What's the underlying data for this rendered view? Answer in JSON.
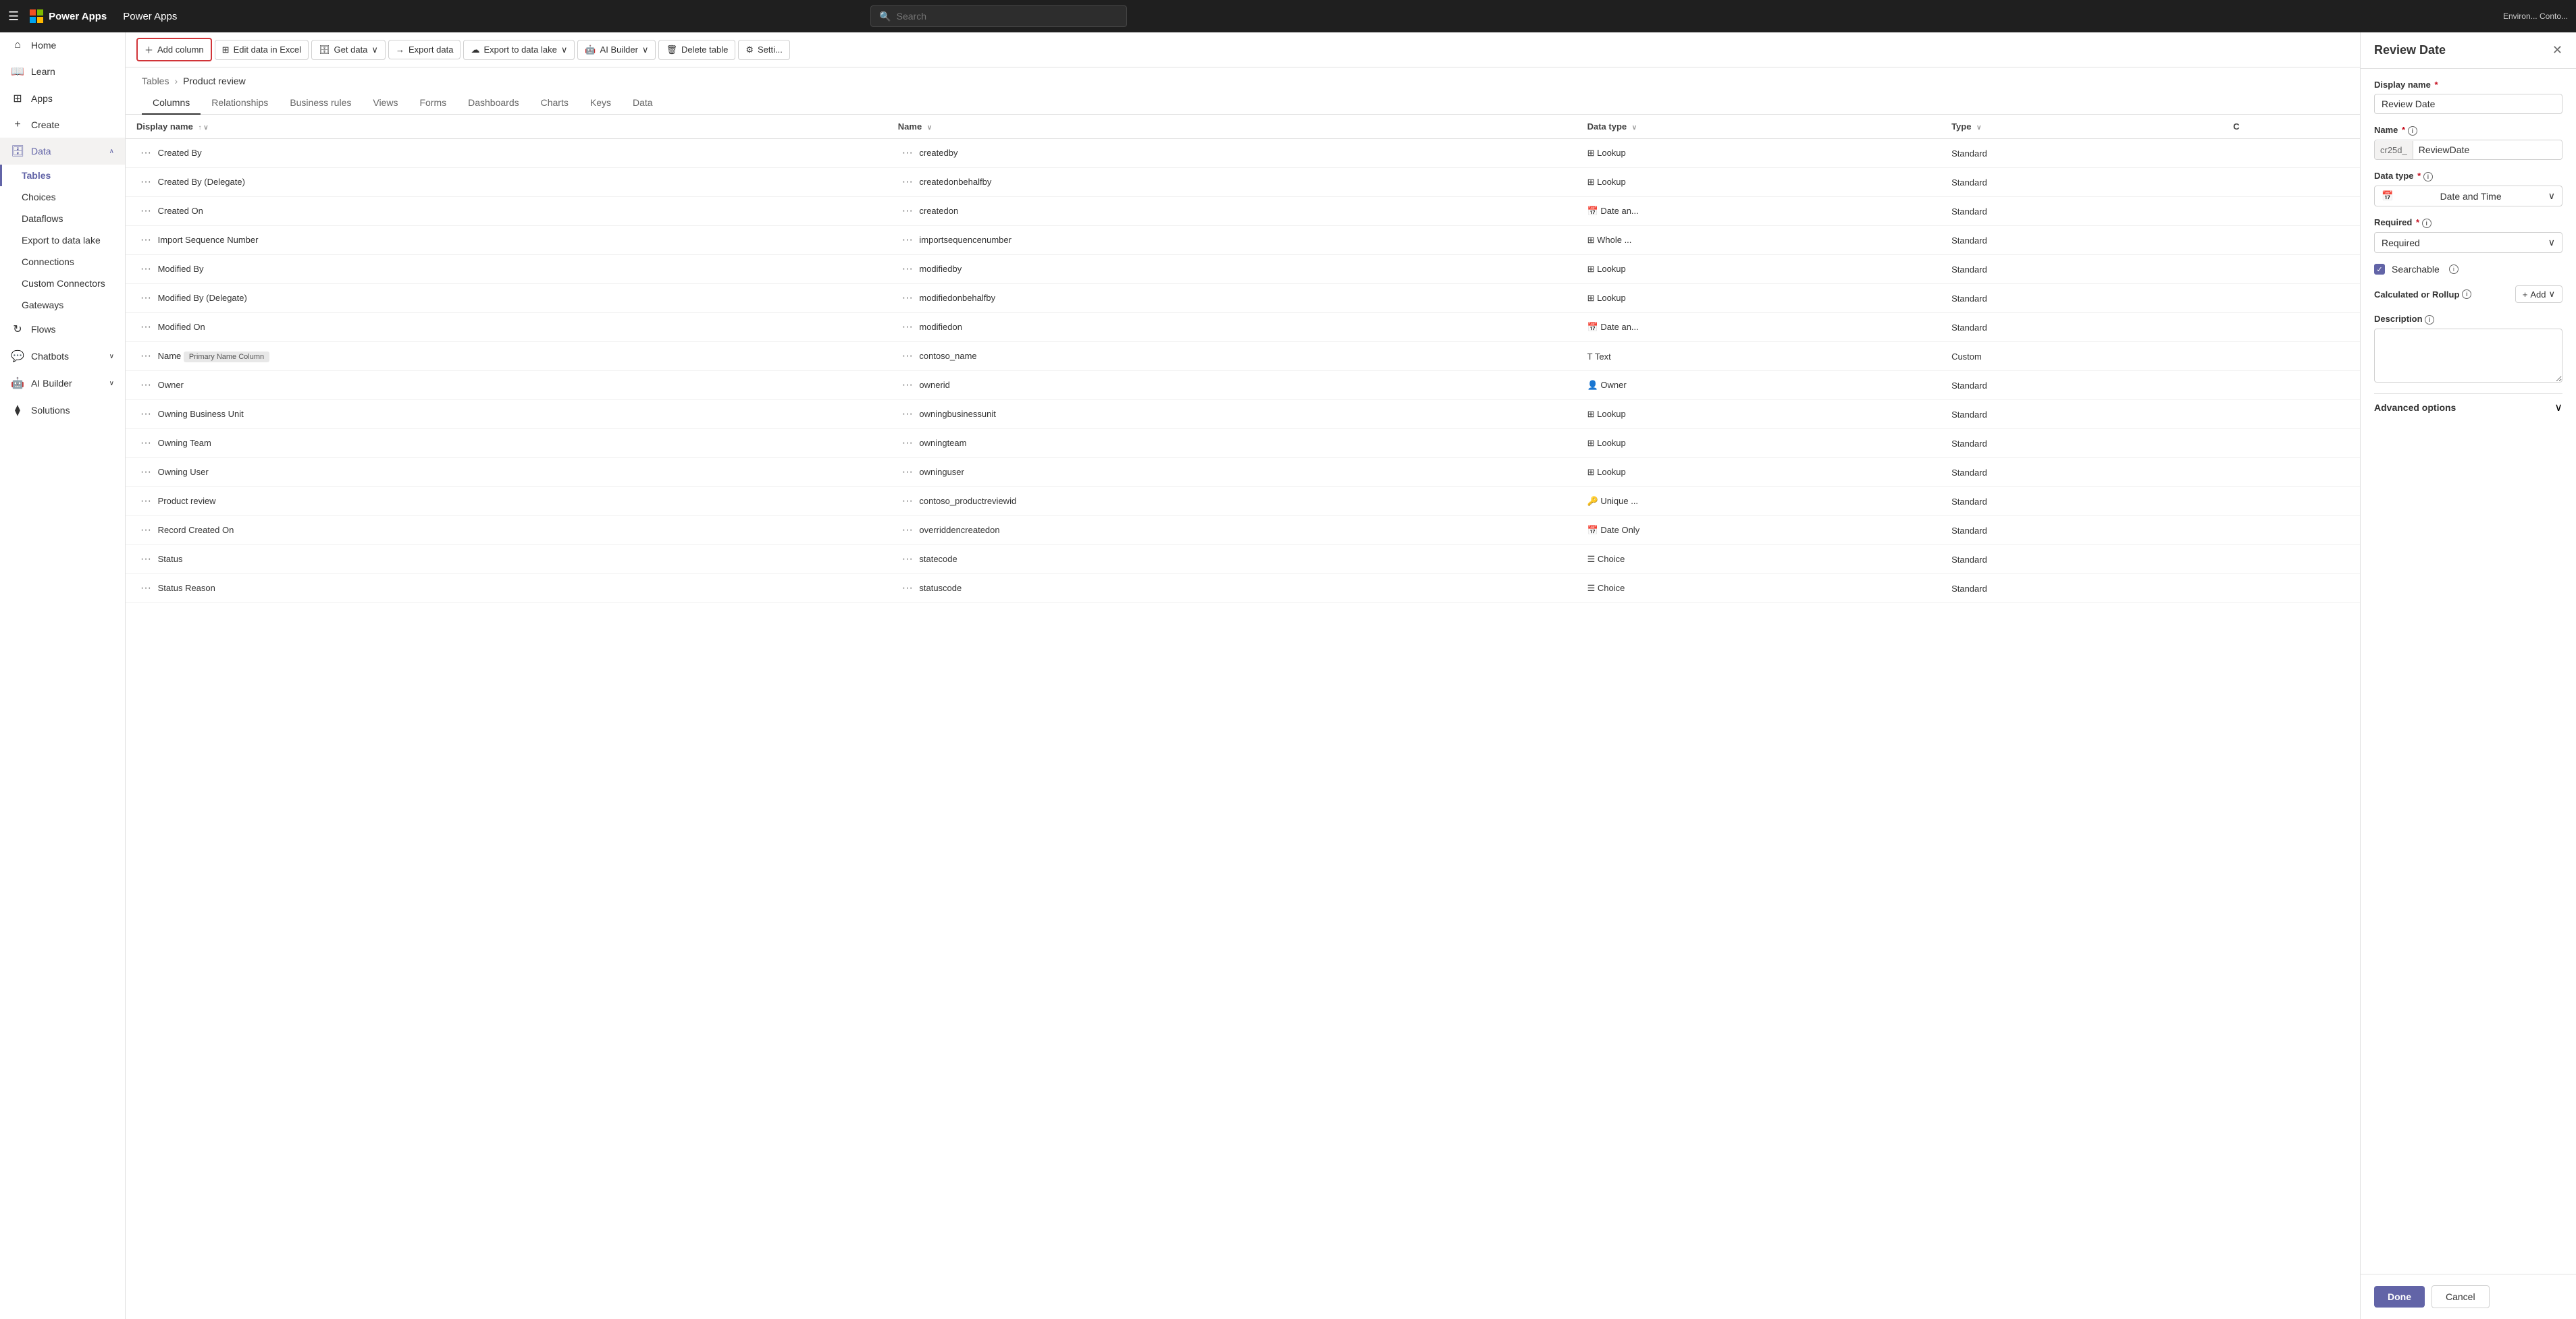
{
  "topnav": {
    "appName": "Power Apps",
    "searchPlaceholder": "Search",
    "envLabel": "Environ... Conto..."
  },
  "sidebar": {
    "items": [
      {
        "id": "home",
        "label": "Home",
        "icon": "⌂",
        "active": false
      },
      {
        "id": "learn",
        "label": "Learn",
        "icon": "📖",
        "active": false
      },
      {
        "id": "apps",
        "label": "Apps",
        "icon": "⊞",
        "active": false
      },
      {
        "id": "create",
        "label": "Create",
        "icon": "+",
        "active": false
      },
      {
        "id": "data",
        "label": "Data",
        "icon": "🗄",
        "active": true,
        "expanded": true
      }
    ],
    "dataSubItems": [
      {
        "id": "tables",
        "label": "Tables",
        "active": true
      },
      {
        "id": "choices",
        "label": "Choices",
        "active": false
      },
      {
        "id": "dataflows",
        "label": "Dataflows",
        "active": false
      },
      {
        "id": "export",
        "label": "Export to data lake",
        "active": false
      },
      {
        "id": "connections",
        "label": "Connections",
        "active": false
      },
      {
        "id": "connectors",
        "label": "Custom Connectors",
        "active": false
      },
      {
        "id": "gateways",
        "label": "Gateways",
        "active": false
      }
    ],
    "bottomItems": [
      {
        "id": "flows",
        "label": "Flows",
        "icon": "↻"
      },
      {
        "id": "chatbots",
        "label": "Chatbots",
        "icon": "💬"
      },
      {
        "id": "aibuilder",
        "label": "AI Builder",
        "icon": "🤖"
      },
      {
        "id": "solutions",
        "label": "Solutions",
        "icon": "⧫"
      }
    ]
  },
  "toolbar": {
    "addColumn": "Add column",
    "editData": "Edit data in Excel",
    "getData": "Get data",
    "exportData": "Export data",
    "exportDataLake": "Export to data lake",
    "aiBuilder": "AI Builder",
    "deleteTable": "Delete table",
    "settings": "Setti..."
  },
  "breadcrumb": {
    "parent": "Tables",
    "current": "Product review"
  },
  "tabs": [
    {
      "id": "columns",
      "label": "Columns",
      "active": true
    },
    {
      "id": "relationships",
      "label": "Relationships",
      "active": false
    },
    {
      "id": "businessrules",
      "label": "Business rules",
      "active": false
    },
    {
      "id": "views",
      "label": "Views",
      "active": false
    },
    {
      "id": "forms",
      "label": "Forms",
      "active": false
    },
    {
      "id": "dashboards",
      "label": "Dashboards",
      "active": false
    },
    {
      "id": "charts",
      "label": "Charts",
      "active": false
    },
    {
      "id": "keys",
      "label": "Keys",
      "active": false
    },
    {
      "id": "data",
      "label": "Data",
      "active": false
    }
  ],
  "table": {
    "headers": [
      {
        "id": "displayname",
        "label": "Display name",
        "sortable": true,
        "sortDir": "asc"
      },
      {
        "id": "name",
        "label": "Name",
        "sortable": true
      },
      {
        "id": "datatype",
        "label": "Data type",
        "sortable": true
      },
      {
        "id": "type",
        "label": "Type",
        "sortable": true
      },
      {
        "id": "c",
        "label": "C",
        "sortable": false
      }
    ],
    "rows": [
      {
        "displayName": "Created By",
        "name": "createdby",
        "dataType": "Lookup",
        "dataTypeIcon": "⊞",
        "type": "Standard"
      },
      {
        "displayName": "Created By (Delegate)",
        "name": "createdonbehalfby",
        "dataType": "Lookup",
        "dataTypeIcon": "⊞",
        "type": "Standard"
      },
      {
        "displayName": "Created On",
        "name": "createdon",
        "dataType": "Date an...",
        "dataTypeIcon": "📅",
        "type": "Standard"
      },
      {
        "displayName": "Import Sequence Number",
        "name": "importsequencenumber",
        "dataType": "Whole ...",
        "dataTypeIcon": "⊞",
        "type": "Standard"
      },
      {
        "displayName": "Modified By",
        "name": "modifiedby",
        "dataType": "Lookup",
        "dataTypeIcon": "⊞",
        "type": "Standard"
      },
      {
        "displayName": "Modified By (Delegate)",
        "name": "modifiedonbehalfby",
        "dataType": "Lookup",
        "dataTypeIcon": "⊞",
        "type": "Standard"
      },
      {
        "displayName": "Modified On",
        "name": "modifiedon",
        "dataType": "Date an...",
        "dataTypeIcon": "📅",
        "type": "Standard"
      },
      {
        "displayName": "Name",
        "badge": "Primary Name Column",
        "name": "contoso_name",
        "dataType": "Text",
        "dataTypeIcon": "T",
        "type": "Custom"
      },
      {
        "displayName": "Owner",
        "name": "ownerid",
        "dataType": "Owner",
        "dataTypeIcon": "👤",
        "type": "Standard"
      },
      {
        "displayName": "Owning Business Unit",
        "name": "owningbusinessunit",
        "dataType": "Lookup",
        "dataTypeIcon": "⊞",
        "type": "Standard"
      },
      {
        "displayName": "Owning Team",
        "name": "owningteam",
        "dataType": "Lookup",
        "dataTypeIcon": "⊞",
        "type": "Standard"
      },
      {
        "displayName": "Owning User",
        "name": "owninguser",
        "dataType": "Lookup",
        "dataTypeIcon": "⊞",
        "type": "Standard"
      },
      {
        "displayName": "Product review",
        "name": "contoso_productreviewid",
        "dataType": "Unique ...",
        "dataTypeIcon": "🔑",
        "type": "Standard"
      },
      {
        "displayName": "Record Created On",
        "name": "overriddencreatedon",
        "dataType": "Date Only",
        "dataTypeIcon": "📅",
        "type": "Standard"
      },
      {
        "displayName": "Status",
        "name": "statecode",
        "dataType": "Choice",
        "dataTypeIcon": "☰",
        "type": "Standard"
      },
      {
        "displayName": "Status Reason",
        "name": "statuscode",
        "dataType": "Choice",
        "dataTypeIcon": "☰",
        "type": "Standard"
      }
    ]
  },
  "panel": {
    "title": "Review Date",
    "displayNameLabel": "Display name",
    "displayNameValue": "Review Date",
    "nameLabel": "Name",
    "namePrefix": "cr25d_",
    "nameSuffix": "ReviewDate",
    "dataTypeLabel": "Data type",
    "dataTypeIcon": "📅",
    "dataTypeValue": "Date and Time",
    "requiredLabel": "Required",
    "requiredValue": "Required",
    "searchableLabel": "Searchable",
    "searchableChecked": true,
    "calcRollupLabel": "Calculated or Rollup",
    "addLabel": "+ Add",
    "descriptionLabel": "Description",
    "descriptionValue": "",
    "advancedLabel": "Advanced options",
    "doneLabel": "Done",
    "cancelLabel": "Cancel"
  }
}
